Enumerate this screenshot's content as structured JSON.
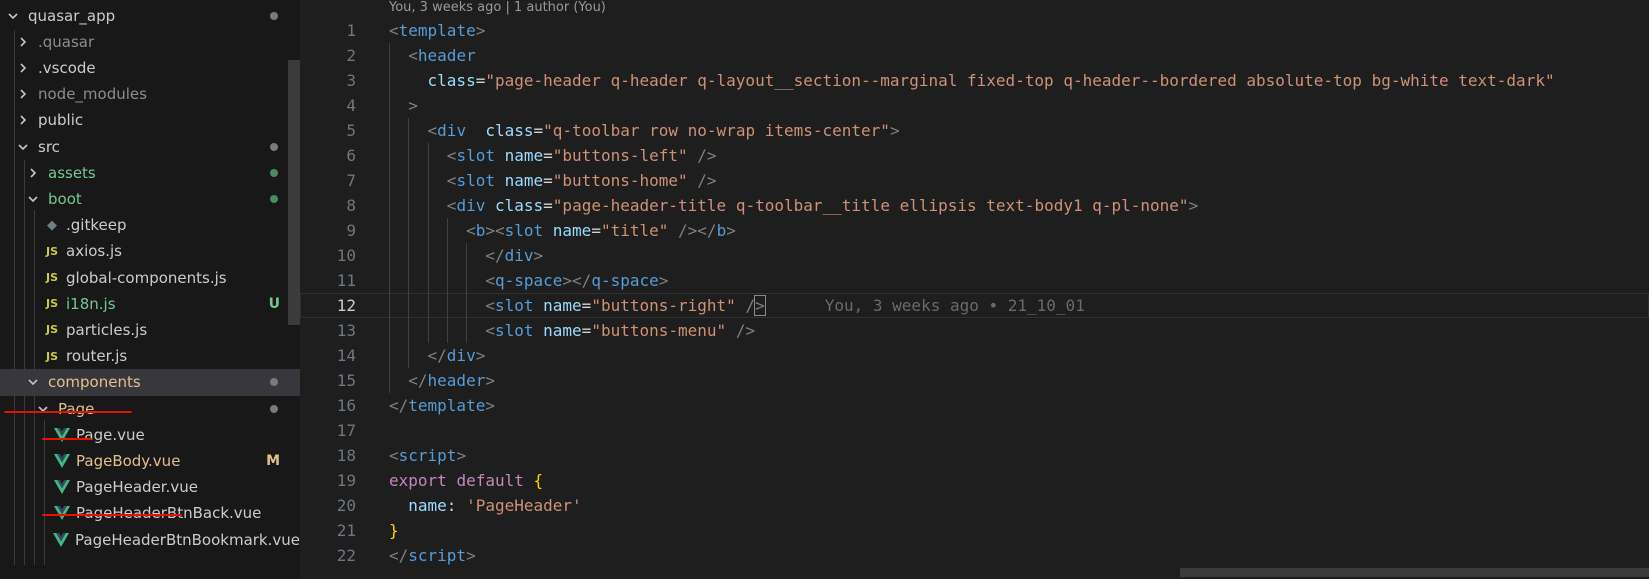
{
  "explorer": {
    "items": [
      {
        "label": "quasar_app",
        "depth": 0,
        "kind": "folder-open",
        "color": "#cccccc",
        "marker": "dot",
        "marker_color": "#7a7a7a"
      },
      {
        "label": ".quasar",
        "depth": 1,
        "kind": "folder",
        "color": "#8c8c8c"
      },
      {
        "label": ".vscode",
        "depth": 1,
        "kind": "folder",
        "color": "#cccccc"
      },
      {
        "label": "node_modules",
        "depth": 1,
        "kind": "folder",
        "color": "#8c8c8c"
      },
      {
        "label": "public",
        "depth": 1,
        "kind": "folder",
        "color": "#cccccc"
      },
      {
        "label": "src",
        "depth": 1,
        "kind": "folder-open",
        "color": "#cccccc",
        "marker": "dot",
        "marker_color": "#7a7a7a"
      },
      {
        "label": "assets",
        "depth": 2,
        "kind": "folder",
        "color": "#73c991",
        "marker": "dot",
        "marker_color": "#4c8a5c"
      },
      {
        "label": "boot",
        "depth": 2,
        "kind": "folder-open",
        "color": "#73c991",
        "marker": "dot",
        "marker_color": "#4c8a5c"
      },
      {
        "label": ".gitkeep",
        "depth": 3,
        "kind": "keep-file",
        "color": "#cccccc"
      },
      {
        "label": "axios.js",
        "depth": 3,
        "kind": "js-file",
        "color": "#cccccc"
      },
      {
        "label": "global-components.js",
        "depth": 3,
        "kind": "js-file",
        "color": "#cccccc"
      },
      {
        "label": "i18n.js",
        "depth": 3,
        "kind": "js-file",
        "color": "#73c991",
        "marker": "badge",
        "badge_text": "U",
        "marker_color": "#73c991"
      },
      {
        "label": "particles.js",
        "depth": 3,
        "kind": "js-file",
        "color": "#cccccc"
      },
      {
        "label": "router.js",
        "depth": 3,
        "kind": "js-file",
        "color": "#cccccc"
      },
      {
        "label": "components",
        "depth": 2,
        "kind": "folder-open",
        "color": "#e2c08d",
        "marker": "dot",
        "marker_color": "#7a7a7a",
        "selected": true
      },
      {
        "label": "Page",
        "depth": 3,
        "kind": "folder-open",
        "color": "#e2c08d",
        "marker": "dot",
        "marker_color": "#7a7a7a"
      },
      {
        "label": "Page.vue",
        "depth": 4,
        "kind": "vue-file",
        "color": "#cccccc"
      },
      {
        "label": "PageBody.vue",
        "depth": 4,
        "kind": "vue-file",
        "color": "#e2c08d",
        "marker": "badge",
        "badge_text": "M",
        "marker_color": "#e2c08d"
      },
      {
        "label": "PageHeader.vue",
        "depth": 4,
        "kind": "vue-file",
        "color": "#cccccc"
      },
      {
        "label": "PageHeaderBtnBack.vue",
        "depth": 4,
        "kind": "vue-file",
        "color": "#cccccc"
      },
      {
        "label": "PageHeaderBtnBookmark.vue",
        "depth": 4,
        "kind": "vue-file",
        "color": "#cccccc"
      }
    ]
  },
  "editor": {
    "codelens": "You, 3 weeks ago | 1 author (You)",
    "blame_text": "You, 3 weeks ago • 21_10_01",
    "current_line": 12,
    "lines": [
      [
        [
          "t-br",
          "<"
        ],
        [
          "t-tag",
          "template"
        ],
        [
          "t-br",
          ">"
        ]
      ],
      [
        [
          "",
          "  "
        ],
        [
          "t-br",
          "<"
        ],
        [
          "t-tag",
          "header"
        ]
      ],
      [
        [
          "",
          "    "
        ],
        [
          "t-attr",
          "class"
        ],
        [
          "t-eq",
          "="
        ],
        [
          "t-str",
          "\"page-header q-header q-layout__section--marginal fixed-top q-header--bordered absolute-top bg-white text-dark\""
        ]
      ],
      [
        [
          "",
          "  "
        ],
        [
          "t-br",
          ">"
        ]
      ],
      [
        [
          "",
          "    "
        ],
        [
          "t-br",
          "<"
        ],
        [
          "t-tag",
          "div"
        ],
        [
          "",
          "  "
        ],
        [
          "t-attr",
          "class"
        ],
        [
          "t-eq",
          "="
        ],
        [
          "t-str",
          "\"q-toolbar row no-wrap items-center\""
        ],
        [
          "t-br",
          ">"
        ]
      ],
      [
        [
          "",
          "      "
        ],
        [
          "t-br",
          "<"
        ],
        [
          "t-tag",
          "slot"
        ],
        [
          "",
          " "
        ],
        [
          "t-attr",
          "name"
        ],
        [
          "t-eq",
          "="
        ],
        [
          "t-str",
          "\"buttons-left\""
        ],
        [
          "",
          " "
        ],
        [
          "t-br",
          "/>"
        ]
      ],
      [
        [
          "",
          "      "
        ],
        [
          "t-br",
          "<"
        ],
        [
          "t-tag",
          "slot"
        ],
        [
          "",
          " "
        ],
        [
          "t-attr",
          "name"
        ],
        [
          "t-eq",
          "="
        ],
        [
          "t-str",
          "\"buttons-home\""
        ],
        [
          "",
          " "
        ],
        [
          "t-br",
          "/>"
        ]
      ],
      [
        [
          "",
          "      "
        ],
        [
          "t-br",
          "<"
        ],
        [
          "t-tag",
          "div"
        ],
        [
          "",
          " "
        ],
        [
          "t-attr",
          "class"
        ],
        [
          "t-eq",
          "="
        ],
        [
          "t-str",
          "\"page-header-title q-toolbar__title ellipsis text-body1 q-pl-none\""
        ],
        [
          "t-br",
          ">"
        ]
      ],
      [
        [
          "",
          "        "
        ],
        [
          "t-br",
          "<"
        ],
        [
          "t-tag",
          "b"
        ],
        [
          "t-br",
          "><"
        ],
        [
          "t-tag",
          "slot"
        ],
        [
          "",
          " "
        ],
        [
          "t-attr",
          "name"
        ],
        [
          "t-eq",
          "="
        ],
        [
          "t-str",
          "\"title\""
        ],
        [
          "",
          " "
        ],
        [
          "t-br",
          "/></"
        ],
        [
          "t-tag",
          "b"
        ],
        [
          "t-br",
          ">"
        ]
      ],
      [
        [
          "",
          "          "
        ],
        [
          "t-br",
          "</"
        ],
        [
          "t-tag",
          "div"
        ],
        [
          "t-br",
          ">"
        ]
      ],
      [
        [
          "",
          "          "
        ],
        [
          "t-br",
          "<"
        ],
        [
          "t-tag",
          "q-space"
        ],
        [
          "t-br",
          "></"
        ],
        [
          "t-tag",
          "q-space"
        ],
        [
          "t-br",
          ">"
        ]
      ],
      [
        [
          "",
          "          "
        ],
        [
          "t-br",
          "<"
        ],
        [
          "t-tag",
          "slot"
        ],
        [
          "",
          " "
        ],
        [
          "t-attr",
          "name"
        ],
        [
          "t-eq",
          "="
        ],
        [
          "t-str",
          "\"buttons-right\""
        ],
        [
          "",
          " "
        ],
        [
          "t-br",
          "/"
        ],
        [
          "t-br cursor-box",
          ">"
        ]
      ],
      [
        [
          "",
          "          "
        ],
        [
          "t-br",
          "<"
        ],
        [
          "t-tag",
          "slot"
        ],
        [
          "",
          " "
        ],
        [
          "t-attr",
          "name"
        ],
        [
          "t-eq",
          "="
        ],
        [
          "t-str",
          "\"buttons-menu\""
        ],
        [
          "",
          " "
        ],
        [
          "t-br",
          "/>"
        ]
      ],
      [
        [
          "",
          "    "
        ],
        [
          "t-br",
          "</"
        ],
        [
          "t-tag",
          "div"
        ],
        [
          "t-br",
          ">"
        ]
      ],
      [
        [
          "",
          "  "
        ],
        [
          "t-br",
          "</"
        ],
        [
          "t-tag",
          "header"
        ],
        [
          "t-br",
          ">"
        ]
      ],
      [
        [
          "t-br",
          "</"
        ],
        [
          "t-tag",
          "template"
        ],
        [
          "t-br",
          ">"
        ]
      ],
      [],
      [
        [
          "t-br",
          "<"
        ],
        [
          "t-tag",
          "script"
        ],
        [
          "t-br",
          ">"
        ]
      ],
      [
        [
          "t-kw",
          "export"
        ],
        [
          "",
          " "
        ],
        [
          "t-kw",
          "default"
        ],
        [
          "",
          " "
        ],
        [
          "t-brace",
          "{"
        ]
      ],
      [
        [
          "",
          "  "
        ],
        [
          "t-prop",
          "name"
        ],
        [
          "t-eq",
          ": "
        ],
        [
          "t-str",
          "'PageHeader'"
        ]
      ],
      [
        [
          "t-brace",
          "}"
        ]
      ],
      [
        [
          "t-br",
          "</"
        ],
        [
          "t-tag",
          "script"
        ],
        [
          "t-br",
          ">"
        ]
      ]
    ]
  }
}
